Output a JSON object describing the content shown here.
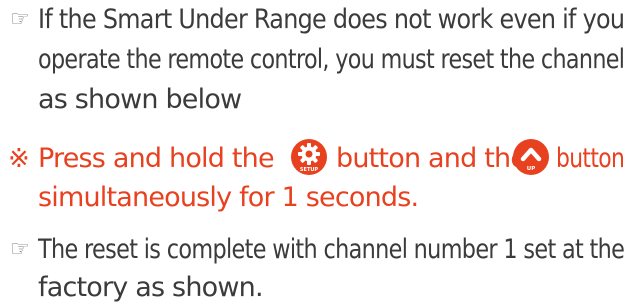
{
  "note1": {
    "icon": "pointing-hand-icon",
    "line1": "If the Smart Under Range does not work even if you",
    "line2": "operate the remote control, you must reset the channel",
    "line3": "as shown below"
  },
  "instruction": {
    "mark": "※",
    "part1": "Press and hold the",
    "setup_button_label": "SETUP",
    "part2": "button and the",
    "up_button_label": "UP",
    "part3": "button",
    "line2": "simultaneously for 1 seconds."
  },
  "note2": {
    "icon": "pointing-hand-icon",
    "line1": "The reset is complete with channel number 1 set at the",
    "line2": "factory as shown."
  },
  "colors": {
    "text": "#3b3b3b",
    "accent": "#e8411f"
  }
}
